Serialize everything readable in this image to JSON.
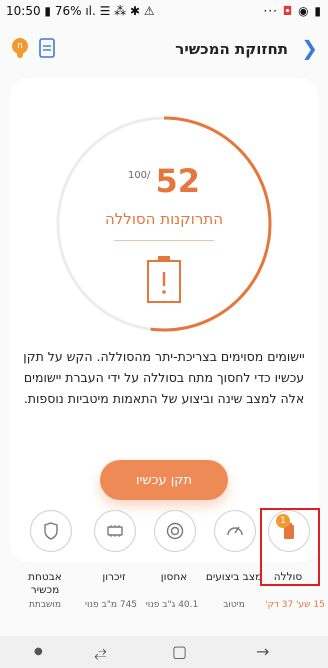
{
  "status_bar": {
    "time": "10:50",
    "battery": "76%",
    "right_icons": "··· ◘ ◉ ▮"
  },
  "header": {
    "title": "תחזוקת המכשיר",
    "notification_count": "n"
  },
  "battery_panel": {
    "score": "52",
    "score_max": "100/",
    "label": "התרוקנות הסוללה",
    "description": "יישומים מסוימים בצריכת-יתר מהסוללה. הקש על תקן עכשיו כדי לחסוך מתח בסוללה על ידי העברת יישומים אלה למצב שינה וביצוע של התאמות מיטביות נוספות.",
    "fix_button": "תקן עכשיו",
    "score_percent": 52
  },
  "tiles": [
    {
      "id": "battery",
      "label": "סוללה",
      "sub": "15 שע' 37 דק'",
      "badge": "1",
      "icon": "battery-icon"
    },
    {
      "id": "performance",
      "label": "מצב ביצועים",
      "sub": "מיטוב",
      "icon": "gauge-icon"
    },
    {
      "id": "storage",
      "label": "אחסון",
      "sub": "40.1 ג\"ב פנוי",
      "icon": "disk-icon"
    },
    {
      "id": "memory",
      "label": "זיכרון",
      "sub": "745 מ\"ב פנוי",
      "icon": "chip-icon"
    },
    {
      "id": "security",
      "label": "אבטחת מכשיר",
      "sub": "מושבתת",
      "icon": "shield-icon"
    }
  ],
  "colors": {
    "accent": "#e6763c",
    "button": "#ee8a55",
    "badge": "#f29a2e",
    "highlight": "#e02020",
    "back_chevron": "#3b7bd6"
  }
}
